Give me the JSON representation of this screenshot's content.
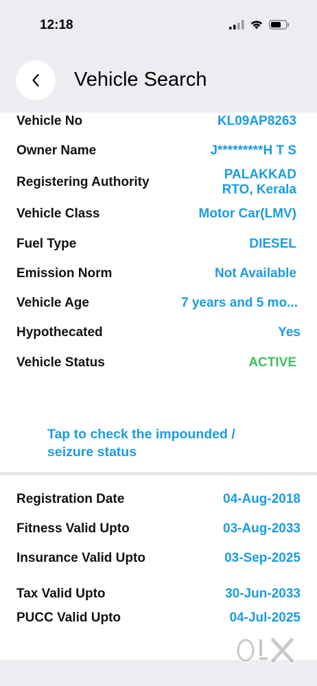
{
  "status_bar": {
    "time": "12:18"
  },
  "header": {
    "title": "Vehicle Search"
  },
  "details": [
    {
      "label": "Vehicle No",
      "value": "KL09AP8263"
    },
    {
      "label": "Owner Name",
      "value": "J*********H T S"
    },
    {
      "label": "Registering Authority",
      "value_line1": "PALAKKAD",
      "value_line2": "RTO, Kerala"
    },
    {
      "label": "Vehicle Class",
      "value": "Motor Car(LMV)"
    },
    {
      "label": "Fuel Type",
      "value": "DIESEL"
    },
    {
      "label": "Emission Norm",
      "value": "Not Available"
    },
    {
      "label": "Vehicle Age",
      "value": "7 years and 5 mo..."
    },
    {
      "label": "Hypothecated",
      "value": "Yes"
    },
    {
      "label": "Vehicle Status",
      "value": "ACTIVE"
    }
  ],
  "impound_link": {
    "line1": "Tap to check the impounded /",
    "line2": "seizure status"
  },
  "validity": [
    {
      "label": "Registration Date",
      "value": "04-Aug-2018"
    },
    {
      "label": "Fitness Valid Upto",
      "value": "03-Aug-2033"
    },
    {
      "label": "Insurance Valid Upto",
      "value": "03-Sep-2025"
    },
    {
      "label": "Tax Valid Upto",
      "value": "30-Jun-2033"
    },
    {
      "label": "PUCC Valid Upto",
      "value": "04-Jul-2025"
    }
  ],
  "colors": {
    "accent": "#1a9ce0",
    "active": "#3fbf63",
    "header_bg": "#ebedf0"
  },
  "watermark": {
    "text": "OLX"
  }
}
